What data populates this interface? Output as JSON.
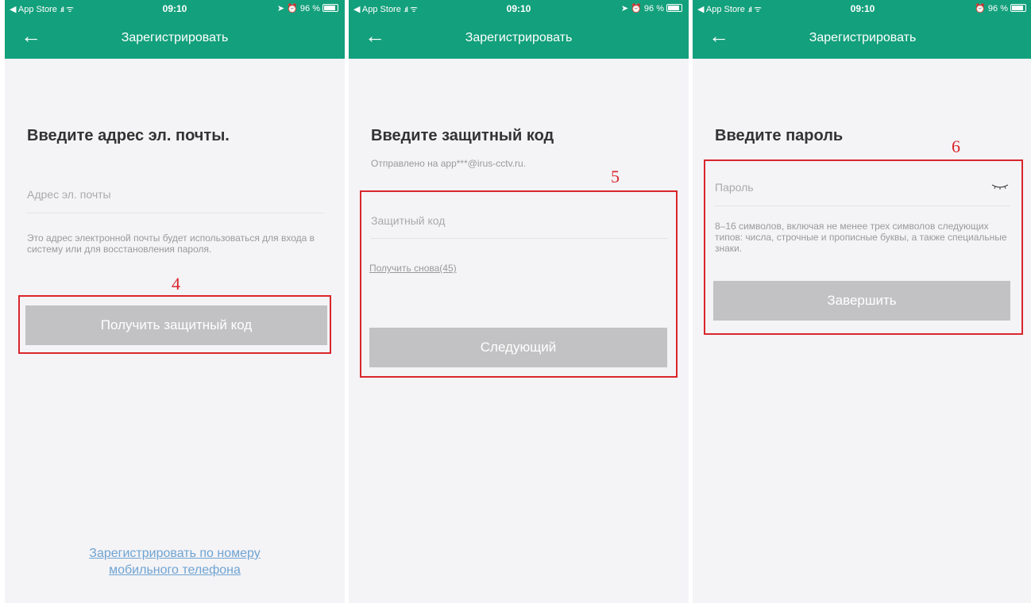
{
  "status": {
    "back_app": "App Store",
    "signal": ".ıll",
    "wifi": "ᯤ",
    "time": "09:10",
    "right_with_location": "➤ ⏰ 96 %",
    "right_no_location": "⏰ 96 %"
  },
  "nav": {
    "back": "←",
    "title": "Зарегистрировать"
  },
  "screen1": {
    "heading": "Введите адрес эл. почты.",
    "email_placeholder": "Адрес эл. почты",
    "hint": "Это адрес электронной почты будет использоваться для входа в систему или для восстановления пароля.",
    "step": "4",
    "button": "Получить защитный код",
    "register_phone_line1": "Зарегистрировать по номеру",
    "register_phone_line2": "мобильного телефона"
  },
  "screen2": {
    "heading": "Введите защитный код",
    "sent_to": "Отправлено на app***@irus-cctv.ru.",
    "step": "5",
    "code_placeholder": "Защитный код",
    "resend": "Получить снова(45)",
    "button": "Следующий"
  },
  "screen3": {
    "heading": "Введите пароль",
    "step": "6",
    "password_placeholder": "Пароль",
    "hint": "8–16 символов, включая не менее трех символов следующих типов: числа, строчные и прописные буквы, а также специальные знаки.",
    "button": "Завершить"
  },
  "colors": {
    "header": "#13a07c",
    "button": "#c2c2c4",
    "highlight": "#d9262b",
    "link": "#6fa4d2"
  }
}
